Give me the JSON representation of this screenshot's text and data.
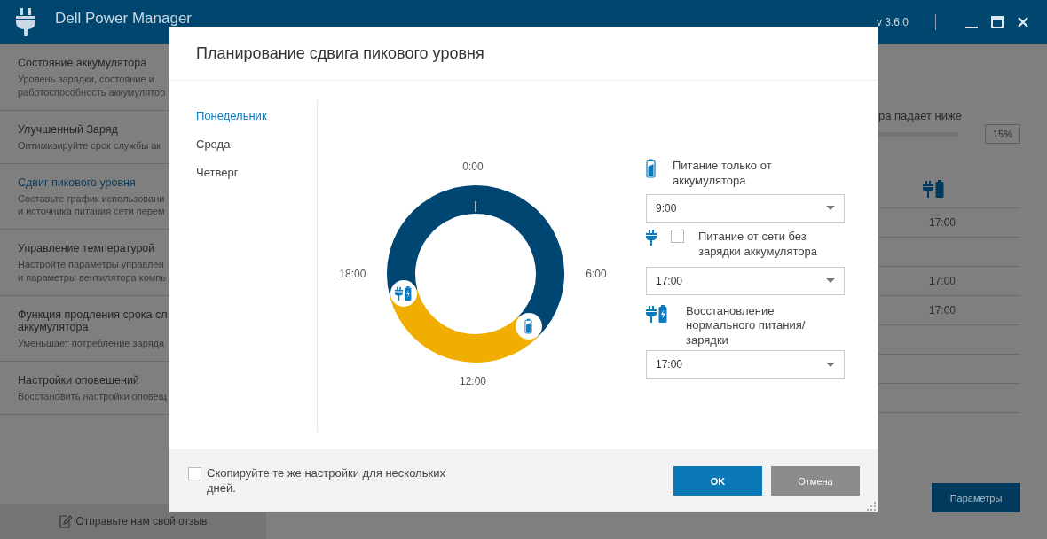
{
  "window": {
    "title": "Dell Power Manager",
    "version": "v 3.6.0"
  },
  "sidebar": {
    "items": [
      {
        "title": "Состояние аккумулятора",
        "description_lines": [
          "Уровень зарядки, состояние и",
          "работоспособность аккумулятор"
        ],
        "selected": false
      },
      {
        "title": "Улучшенный Заряд",
        "description_lines": [
          "Оптимизируйте срок службы ак"
        ],
        "selected": false
      },
      {
        "title": "Сдвиг пикового уровня",
        "description_lines": [
          "Составьте график использовани",
          "и источника питания сети перем"
        ],
        "selected": true
      },
      {
        "title": "Управление температурой",
        "description_lines": [
          "Настройте параметры управлен",
          "и параметры вентилятора компь"
        ],
        "selected": false
      },
      {
        "title": "Функция продления срока сл\nаккумулятора",
        "description_lines": [
          "Уменьшает потребление заряда"
        ],
        "selected": false
      },
      {
        "title": "Настройки оповещений",
        "description_lines": [
          "Восстановить настройки оповещ"
        ],
        "selected": false
      }
    ],
    "feedback_link": "Отправьте нам свой отзыв"
  },
  "main": {
    "threshold_text": "ра падает ниже",
    "threshold_value": "15%",
    "schedule_rows": [
      {
        "time": "17:00"
      },
      {},
      {
        "time": "17:00"
      },
      {
        "time": "17:00"
      },
      {},
      {},
      {}
    ],
    "settings_button": "Параметры"
  },
  "dialog": {
    "title": "Планирование сдвига пикового уровня",
    "days": [
      {
        "label": "Понедельник",
        "selected": true
      },
      {
        "label": "Среда",
        "selected": false
      },
      {
        "label": "Четверг",
        "selected": false
      }
    ],
    "ring_labels": {
      "top": "0:00",
      "right": "6:00",
      "bottom": "12:00",
      "left": "18:00"
    },
    "options": [
      {
        "kind": "battery",
        "label": "Питание только от аккумулятора",
        "value": "9:00"
      },
      {
        "kind": "ac",
        "label": "Питание от сети без зарядки аккумулятора",
        "value": "17:00",
        "checked": false
      },
      {
        "kind": "normal",
        "label": "Восстановление нормального питания/ зарядки",
        "value": "17:00"
      }
    ],
    "copy_checkbox": {
      "label": "Скопируйте те же настройки для нескольких дней.",
      "checked": false
    },
    "ok_button": "OK",
    "cancel_button": "Отмена"
  }
}
